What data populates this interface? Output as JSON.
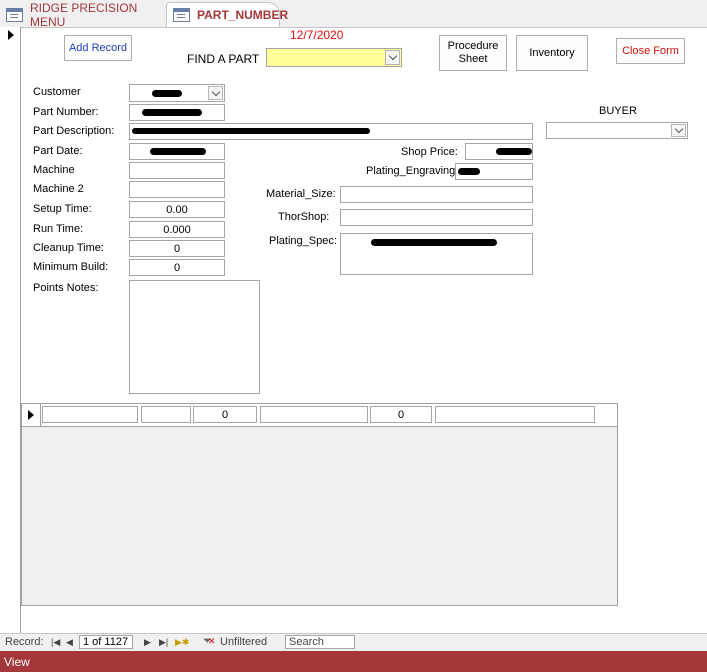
{
  "tabs": [
    {
      "label": "RIDGE PRECISION MENU",
      "active": false
    },
    {
      "label": "PART_NUMBER",
      "active": true
    }
  ],
  "header": {
    "date": "12/7/2020",
    "find_label": "FIND A PART",
    "find_value": ""
  },
  "buttons": {
    "add_record": "Add Record",
    "procedure_sheet_line1": "Procedure",
    "procedure_sheet_line2": "Sheet",
    "inventory": "Inventory",
    "close_form": "Close Form"
  },
  "fields": {
    "customer_label": "Customer",
    "part_number_label": "Part Number:",
    "part_description_label": "Part Description:",
    "part_date_label": "Part Date:",
    "machine_label": "Machine",
    "machine2_label": "Machine 2",
    "setup_time_label": "Setup Time:",
    "setup_time_value": "0.00",
    "run_time_label": "Run Time:",
    "run_time_value": "0.000",
    "cleanup_time_label": "Cleanup Time:",
    "cleanup_time_value": "0",
    "minimum_build_label": "Minimum Build:",
    "minimum_build_value": "0",
    "points_notes_label": "Points Notes:",
    "buyer_label": "BUYER",
    "shop_price_label": "Shop Price:",
    "plating_engraving_label": "Plating_Engraving:",
    "material_size_label": "Material_Size:",
    "thorshop_label": "ThorShop:",
    "plating_spec_label": "Plating_Spec:"
  },
  "subform": {
    "row_values": [
      "",
      "",
      "0",
      "",
      "0",
      ""
    ]
  },
  "navigation": {
    "record_label": "Record:",
    "record_position": "1 of 1127",
    "filter_status": "Unfiltered",
    "search_placeholder": "Search"
  },
  "status": {
    "view_label": "View"
  },
  "colors": {
    "accent": "#a4373a",
    "find_field": "#ffff99",
    "date_text": "#e01010",
    "add_record_text": "#1f3fbf",
    "close_form_text": "#d01010"
  }
}
